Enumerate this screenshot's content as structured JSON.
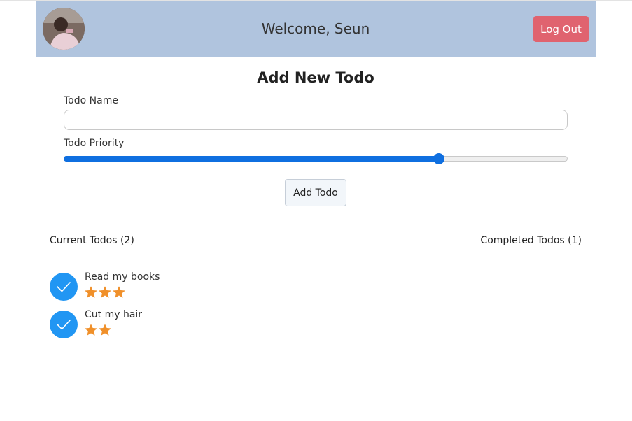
{
  "header": {
    "welcome_text": "Welcome, Seun",
    "logout_label": "Log Out",
    "background_color": "#b0c4de"
  },
  "form": {
    "title": "Add New Todo",
    "name_label": "Todo Name",
    "name_value": "",
    "name_placeholder": "",
    "priority_label": "Todo Priority",
    "priority_fraction": 0.745,
    "add_button_label": "Add Todo"
  },
  "tabs": {
    "current_label": "Current Todos (2)",
    "completed_label": "Completed Todos (1)",
    "active": "current"
  },
  "todos": [
    {
      "name": "Read my books",
      "stars": 3,
      "completed_icon": "check-icon"
    },
    {
      "name": "Cut my hair",
      "stars": 2,
      "completed_icon": "check-icon"
    }
  ],
  "colors": {
    "accent": "#0f6fe0",
    "check": "#2196f3",
    "star": "#f0902a",
    "logout": "#e0636f"
  }
}
